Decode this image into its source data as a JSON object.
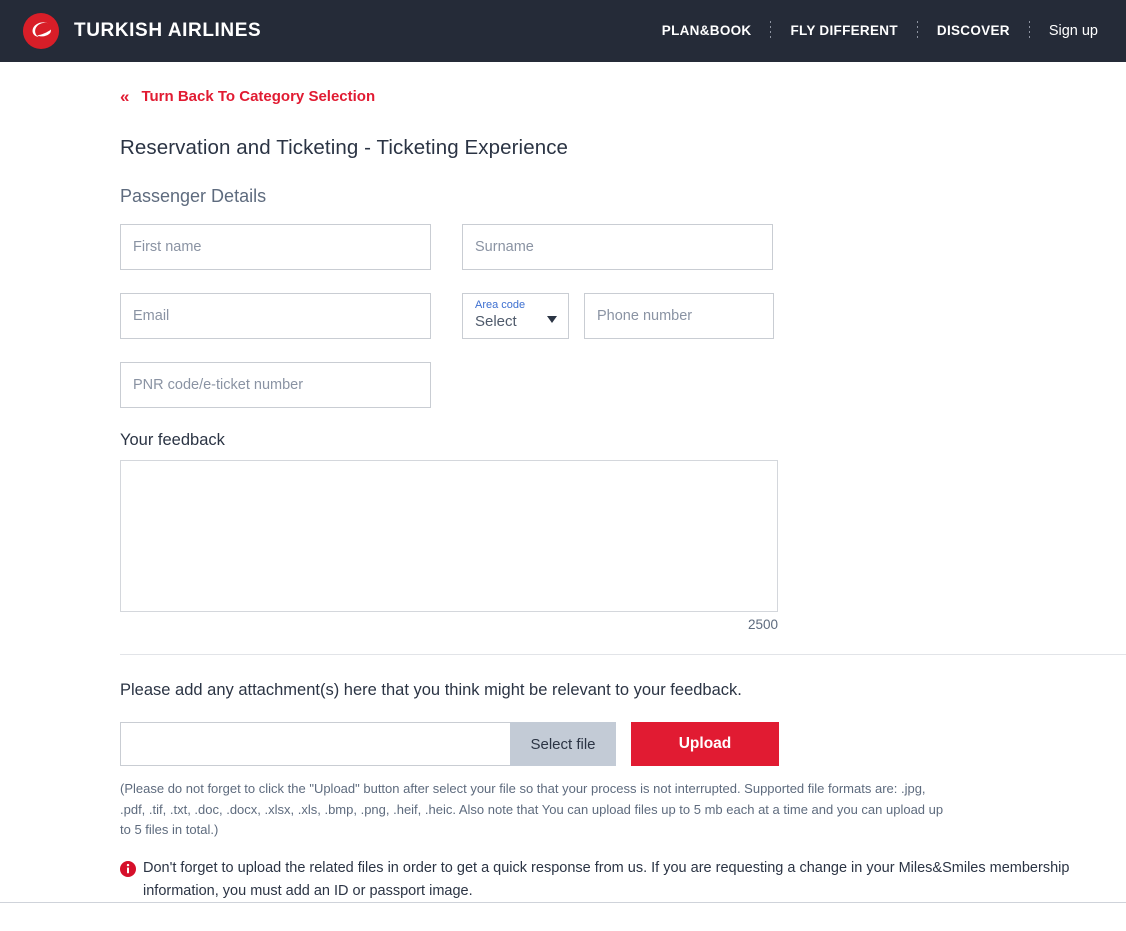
{
  "header": {
    "brand_name": "TURKISH AIRLINES",
    "logo_icon": "turkish-airlines-logo-icon",
    "nav": [
      {
        "label": "PLAN&BOOK",
        "style": "bold"
      },
      {
        "label": "FLY DIFFERENT",
        "style": "bold"
      },
      {
        "label": "DISCOVER",
        "style": "bold"
      },
      {
        "label": "Sign up",
        "style": "soft"
      }
    ],
    "background_color": "#252b38"
  },
  "back_link": {
    "icon": "double-chevron-left-icon",
    "label": "Turn Back To Category Selection",
    "color": "#e11b32"
  },
  "page_title": "Reservation and Ticketing - Ticketing Experience",
  "section_title": "Passenger Details",
  "form": {
    "first_name_placeholder": "First name",
    "surname_placeholder": "Surname",
    "email_placeholder": "Email",
    "area_code_label": "Area code",
    "area_code_value": "Select",
    "area_code_caret_icon": "chevron-down-icon",
    "phone_placeholder": "Phone number",
    "pnr_placeholder": "PNR code/e-ticket number"
  },
  "feedback": {
    "label": "Your feedback",
    "value": "",
    "counter": "2500"
  },
  "attachment": {
    "description": "Please add any attachment(s) here that you think might be relevant to your feedback.",
    "file_input_value": "",
    "select_file_label": "Select file",
    "upload_label": "Upload",
    "upload_color": "#e11b32",
    "select_file_color": "#c3cbd6",
    "fineprint": "(Please do not forget to click the \"Upload\" button after select your file so that your process is not interrupted. Supported file formats are: .jpg, .pdf, .tif, .txt, .doc, .docx, .xlsx, .xls, .bmp, .png, .heif, .heic. Also note that You can upload files up to 5 mb each at a time and you can upload up to 5 files in total.)",
    "warning_icon": "info-circle-icon",
    "warning_text": "Don't forget to upload the related files in order to get a quick response from us. If you are requesting a change in your Miles&Smiles membership information, you must add an ID or passport image."
  }
}
